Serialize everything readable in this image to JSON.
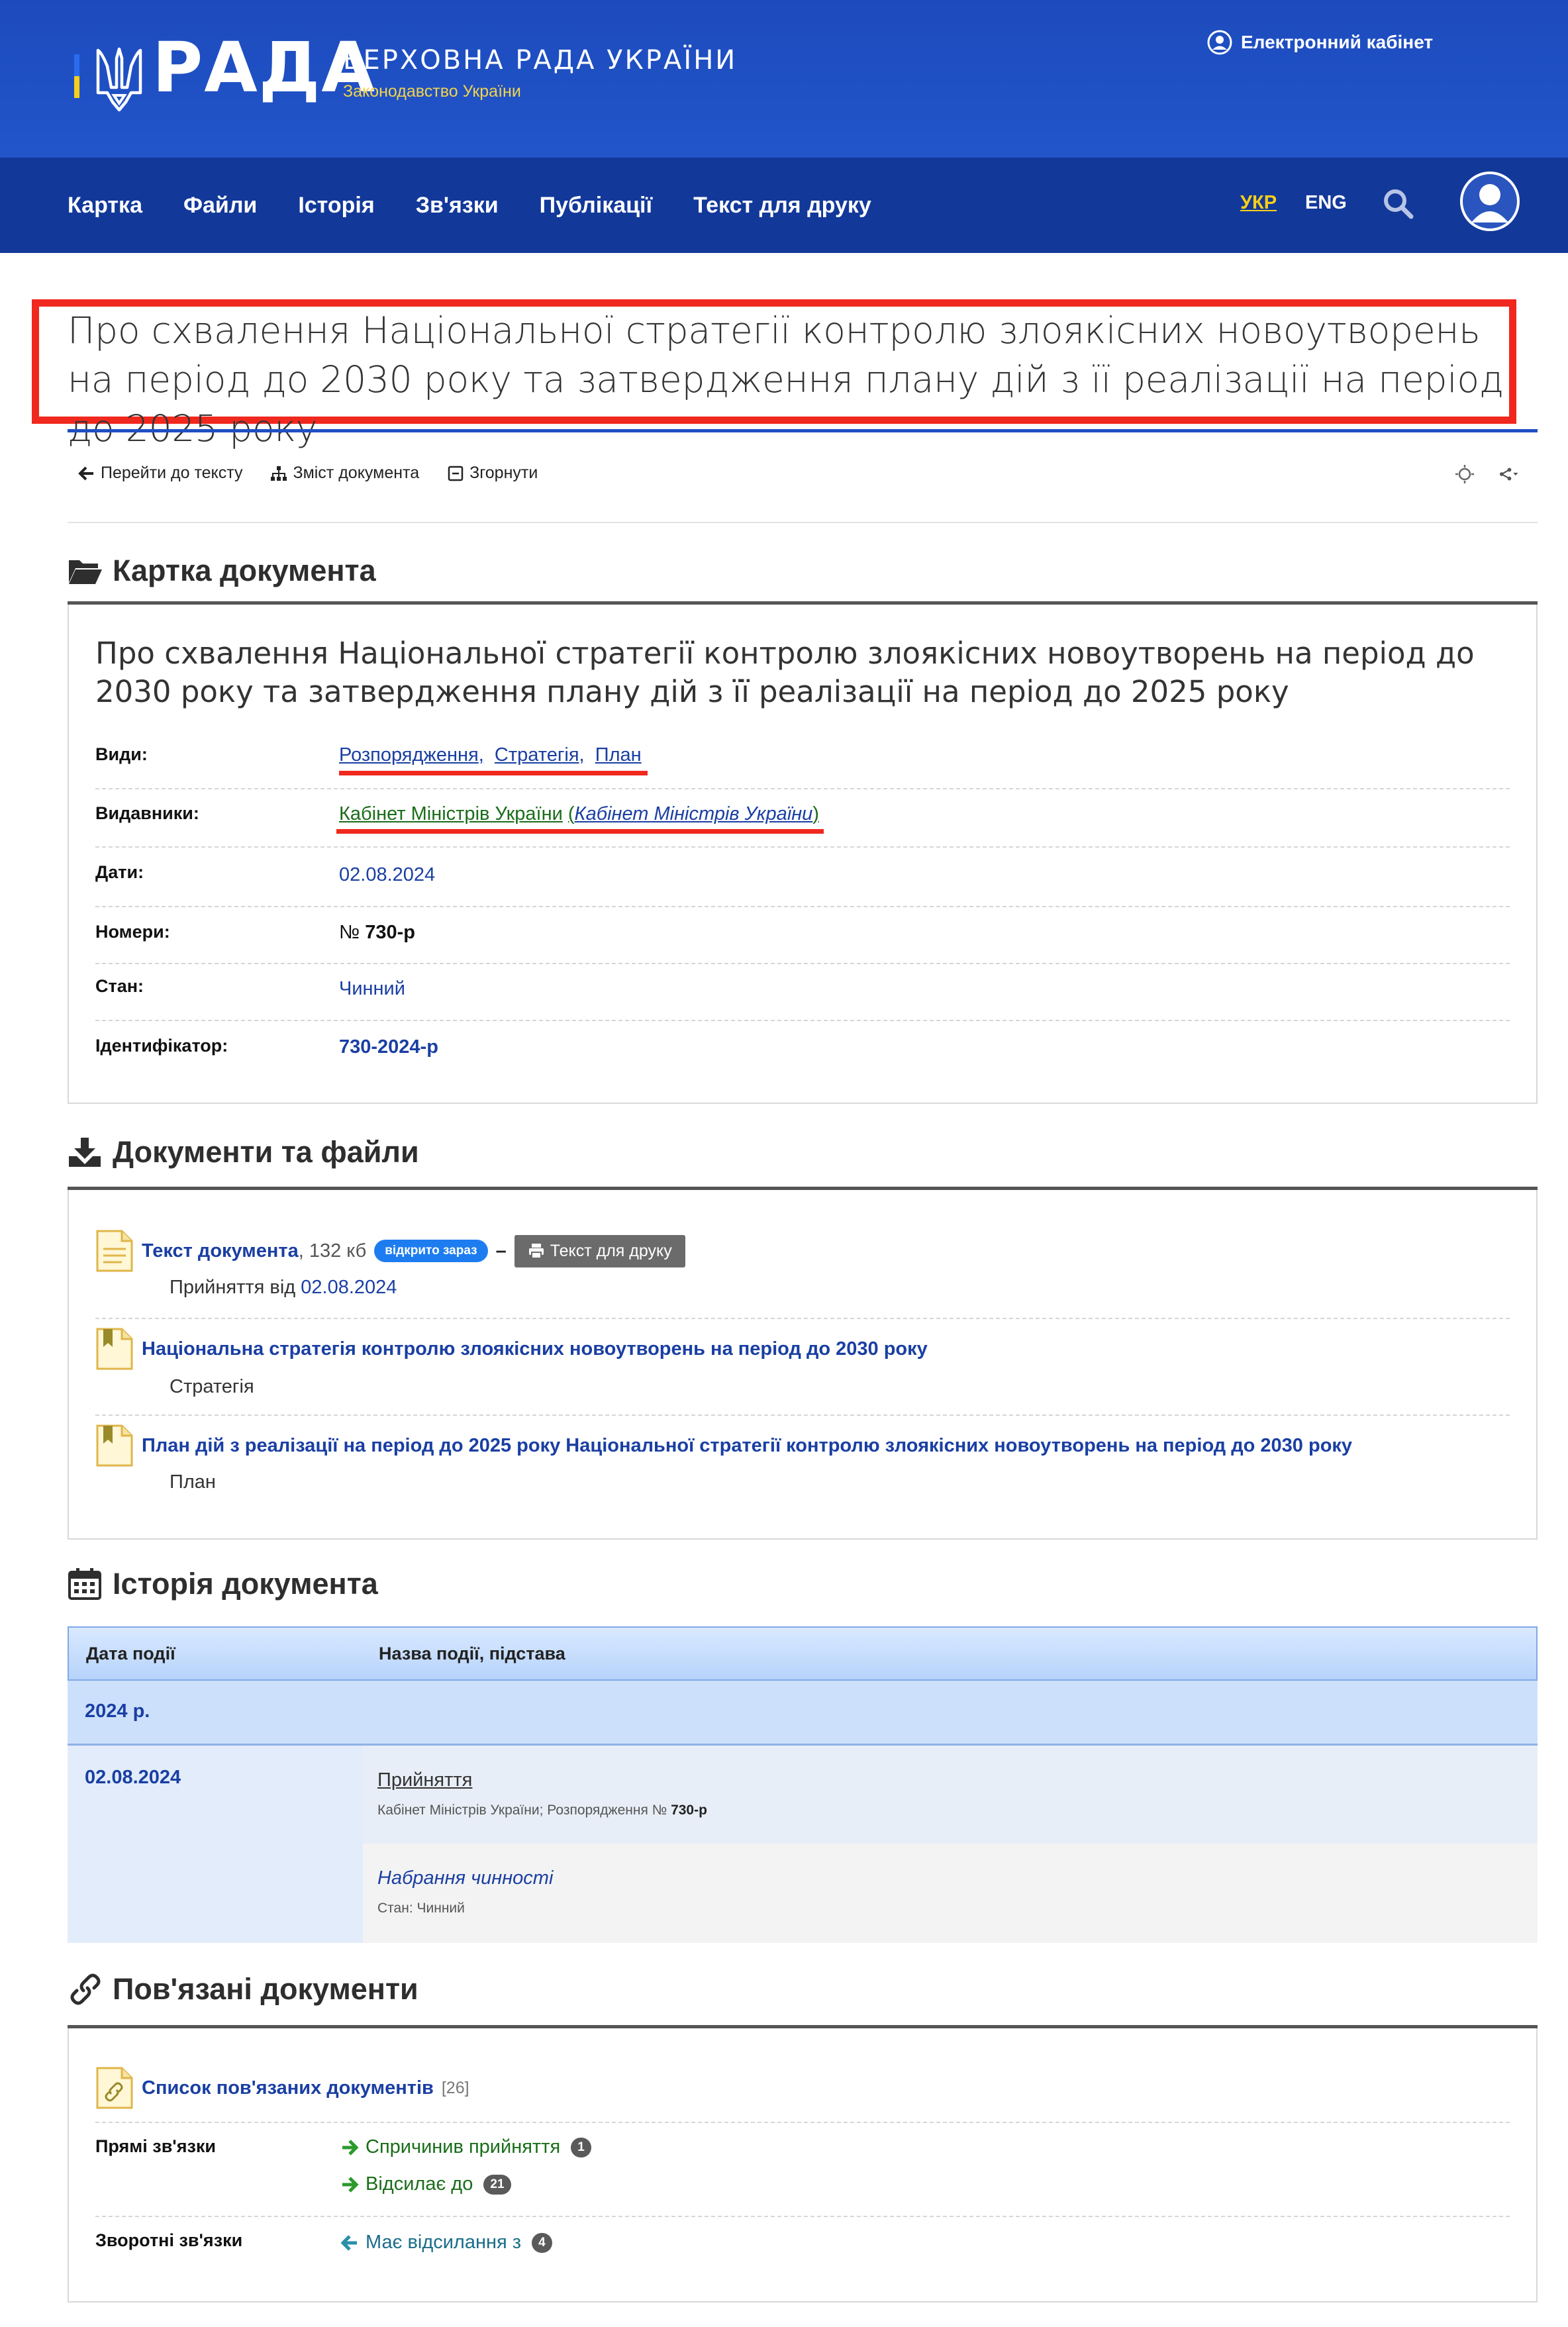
{
  "header": {
    "logo": "РАДА",
    "org_title": "ВЕРХОВНА РАДА УКРАЇНИ",
    "org_subtitle": "Законодавство України",
    "cabinet": "Електронний кабінет"
  },
  "nav": {
    "items": [
      "Картка",
      "Файли",
      "Історія",
      "Зв'язки",
      "Публікації",
      "Текст для друку"
    ],
    "lang_ua": "УКР",
    "lang_en": "ENG"
  },
  "title": "Про схвалення Національної стратегії контролю злоякісних новоутворень на період до 2030 року та затвердження плану дій з її реалізації на період до 2025 року",
  "toolbar": {
    "go_to_text": "Перейти до тексту",
    "contents": "Зміст документа",
    "collapse": "Згорнути"
  },
  "card": {
    "heading": "Картка документа",
    "doc_title": "Про схвалення Національної стратегії контролю злоякісних новоутворень на період до 2030 року та затвердження плану дій з її реалізації на період до 2025 року",
    "types_label": "Види:",
    "types": [
      "Розпорядження",
      "Стратегія",
      "План"
    ],
    "publishers_label": "Видавники:",
    "publisher": "Кабінет Міністрів України",
    "publisher_alt": "Кабінет Міністрів України",
    "dates_label": "Дати:",
    "date": "02.08.2024",
    "numbers_label": "Номери:",
    "number_prefix": "№",
    "number": "730-р",
    "status_label": "Стан:",
    "status": "Чинний",
    "id_label": "Ідентифікатор:",
    "identifier": "730-2024-р"
  },
  "files": {
    "heading": "Документи та файли",
    "items": [
      {
        "link": "Текст документа",
        "size": ", 132 кб",
        "badge": "відкрито зараз",
        "dash": "–",
        "print": "Текст для друку",
        "sub_prefix": "Прийняття від",
        "sub_date": "02.08.2024"
      },
      {
        "link": "Національна стратегія контролю злоякісних новоутворень на період до 2030 року",
        "sub": "Стратегія"
      },
      {
        "link": "План дій з реалізації на період до 2025 року Національної стратегії контролю злоякісних новоутворень на період до 2030 року",
        "sub": "План"
      }
    ]
  },
  "history": {
    "heading": "Історія документа",
    "col_date": "Дата події",
    "col_event": "Назва події, підстава",
    "year": "2024 р.",
    "date": "02.08.2024",
    "event1": "Прийняття",
    "event1_meta": "Кабінет Міністрів України; Розпорядження №",
    "event1_num": "730-р",
    "event2": "Набрання чинності",
    "event2_meta": "Стан: Чинний"
  },
  "related": {
    "heading": "Пов'язані документи",
    "list_link": "Список пов'язаних документів",
    "list_count": "[26]",
    "direct_label": "Прямі зв'язки",
    "direct": [
      {
        "label": "Спричинив прийняття",
        "count": "1"
      },
      {
        "label": "Відсилає до",
        "count": "21"
      }
    ],
    "reverse_label": "Зворотні зв'язки",
    "reverse": [
      {
        "label": "Має відсилання з",
        "count": "4"
      }
    ]
  }
}
